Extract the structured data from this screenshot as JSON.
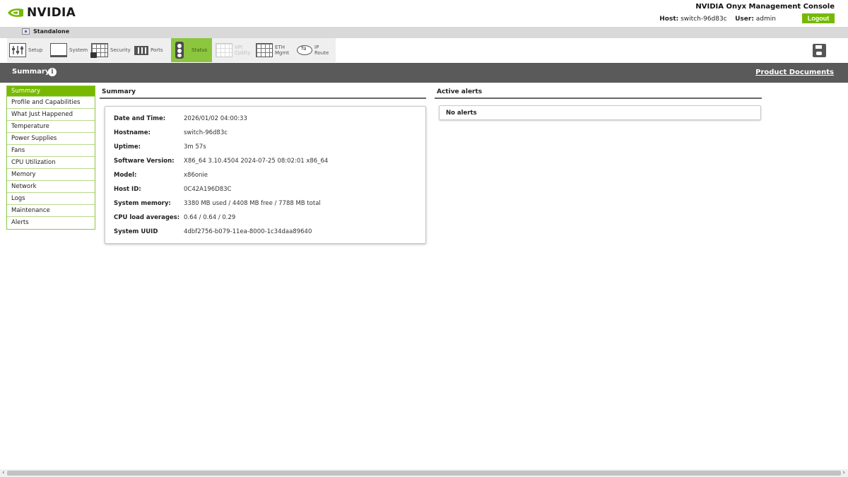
{
  "brand": {
    "name": "NVIDIA",
    "accent": "#76b900"
  },
  "header": {
    "console_title": "NVIDIA Onyx Management Console",
    "host_label": "Host:",
    "host_value": "switch-96d83c",
    "user_label": "User:",
    "user_value": "admin",
    "logout_label": "Logout"
  },
  "mode": {
    "label": "Standalone"
  },
  "toolbar": {
    "tabs": [
      {
        "label": "Setup",
        "icon": "setup-icon"
      },
      {
        "label": "System",
        "icon": "system-icon"
      },
      {
        "label": "Security",
        "icon": "security-icon"
      },
      {
        "label": "Ports",
        "icon": "ports-icon"
      },
      {
        "label": "Status",
        "icon": "traffic-light-icon",
        "active": true
      },
      {
        "label": "VPI\nCpblty",
        "icon": "vpi-icon",
        "disabled": true
      },
      {
        "label": "ETH\nMgmt",
        "icon": "eth-mgmt-icon"
      },
      {
        "label": "IP\nRoute",
        "icon": "router-icon"
      }
    ],
    "save_icon": "save-icon"
  },
  "section": {
    "title": "Summary",
    "docs_link": "Product Documents"
  },
  "menu": {
    "items": [
      "Summary",
      "Profile and Capabilities",
      "What Just Happened",
      "Temperature",
      "Power Supplies",
      "Fans",
      "CPU Utilization",
      "Memory",
      "Network",
      "Logs",
      "Maintenance",
      "Alerts"
    ],
    "active": "Summary"
  },
  "summary": {
    "heading": "Summary",
    "rows": [
      {
        "key": "Date and Time:",
        "value": "2026/01/02 04:00:33"
      },
      {
        "key": "Hostname:",
        "value": "switch-96d83c"
      },
      {
        "key": "Uptime:",
        "value": "3m 57s"
      },
      {
        "key": "Software Version:",
        "value": "X86_64 3.10.4504 2024-07-25 08:02:01 x86_64"
      },
      {
        "key": "Model:",
        "value": "x86onie"
      },
      {
        "key": "Host ID:",
        "value": "0C42A196D83C"
      },
      {
        "key": "System memory:",
        "value": "3380 MB used / 4408 MB free / 7788 MB total"
      },
      {
        "key": "CPU load averages:",
        "value": "0.64 / 0.64 / 0.29"
      },
      {
        "key": "System UUID",
        "value": "4dbf2756-b079-11ea-8000-1c34daa89640"
      }
    ]
  },
  "alerts": {
    "heading": "Active alerts",
    "empty_text": "No alerts"
  }
}
